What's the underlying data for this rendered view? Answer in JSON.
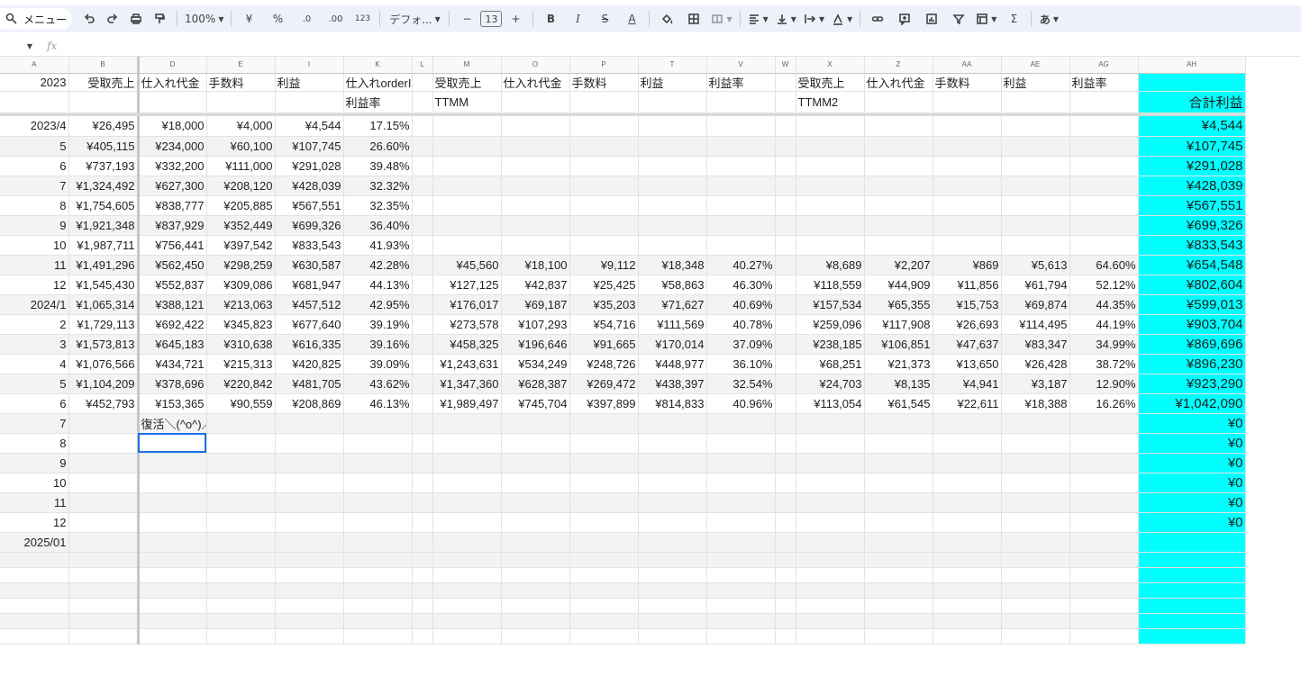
{
  "toolbar": {
    "menu_label": "メニュー",
    "zoom": "100%",
    "yen": "¥",
    "percent": "%",
    "dec_minus": ".0",
    "dec_plus": ".00",
    "num_format": "123",
    "font": "デフォ...",
    "font_size": "13",
    "minus": "−",
    "plus": "+",
    "bold": "B",
    "italic": "I",
    "strike": "S",
    "text_color": "A",
    "sigma": "Σ",
    "input_tools": "あ"
  },
  "formula_bar": {
    "fx": "fx"
  },
  "columns": [
    "A",
    "B",
    "D",
    "E",
    "I",
    "K",
    "L",
    "M",
    "O",
    "P",
    "T",
    "V",
    "W",
    "X",
    "Z",
    "AA",
    "AE",
    "AG",
    "AH"
  ],
  "header1": [
    "2023",
    "受取売上",
    "仕入れ代金",
    "手数料",
    "利益",
    "仕入れorderID",
    "",
    "受取売上",
    "仕入れ代金",
    "手数料",
    "利益",
    "利益率",
    "",
    "受取売上",
    "仕入れ代金",
    "手数料",
    "利益",
    "利益率",
    ""
  ],
  "header2": [
    "",
    "",
    "",
    "",
    "",
    "利益率",
    "",
    "TTMM",
    "",
    "",
    "",
    "",
    "",
    "TTMM2",
    "",
    "",
    "",
    "",
    "合計利益"
  ],
  "rows": [
    [
      "2023/4",
      "¥26,495",
      "¥18,000",
      "¥4,000",
      "¥4,544",
      "17.15%",
      "",
      "",
      "",
      "",
      "",
      "",
      "",
      "",
      "",
      "",
      "",
      "",
      "¥4,544"
    ],
    [
      "5",
      "¥405,115",
      "¥234,000",
      "¥60,100",
      "¥107,745",
      "26.60%",
      "",
      "",
      "",
      "",
      "",
      "",
      "",
      "",
      "",
      "",
      "",
      "",
      "¥107,745"
    ],
    [
      "6",
      "¥737,193",
      "¥332,200",
      "¥111,000",
      "¥291,028",
      "39.48%",
      "",
      "",
      "",
      "",
      "",
      "",
      "",
      "",
      "",
      "",
      "",
      "",
      "¥291,028"
    ],
    [
      "7",
      "¥1,324,492",
      "¥627,300",
      "¥208,120",
      "¥428,039",
      "32.32%",
      "",
      "",
      "",
      "",
      "",
      "",
      "",
      "",
      "",
      "",
      "",
      "",
      "¥428,039"
    ],
    [
      "8",
      "¥1,754,605",
      "¥838,777",
      "¥205,885",
      "¥567,551",
      "32.35%",
      "",
      "",
      "",
      "",
      "",
      "",
      "",
      "",
      "",
      "",
      "",
      "",
      "¥567,551"
    ],
    [
      "9",
      "¥1,921,348",
      "¥837,929",
      "¥352,449",
      "¥699,326",
      "36.40%",
      "",
      "",
      "",
      "",
      "",
      "",
      "",
      "",
      "",
      "",
      "",
      "",
      "¥699,326"
    ],
    [
      "10",
      "¥1,987,711",
      "¥756,441",
      "¥397,542",
      "¥833,543",
      "41.93%",
      "",
      "",
      "",
      "",
      "",
      "",
      "",
      "",
      "",
      "",
      "",
      "",
      "¥833,543"
    ],
    [
      "11",
      "¥1,491,296",
      "¥562,450",
      "¥298,259",
      "¥630,587",
      "42.28%",
      "",
      "¥45,560",
      "¥18,100",
      "¥9,112",
      "¥18,348",
      "40.27%",
      "",
      "¥8,689",
      "¥2,207",
      "¥869",
      "¥5,613",
      "64.60%",
      "¥654,548"
    ],
    [
      "12",
      "¥1,545,430",
      "¥552,837",
      "¥309,086",
      "¥681,947",
      "44.13%",
      "",
      "¥127,125",
      "¥42,837",
      "¥25,425",
      "¥58,863",
      "46.30%",
      "",
      "¥118,559",
      "¥44,909",
      "¥11,856",
      "¥61,794",
      "52.12%",
      "¥802,604"
    ],
    [
      "2024/1",
      "¥1,065,314",
      "¥388,121",
      "¥213,063",
      "¥457,512",
      "42.95%",
      "",
      "¥176,017",
      "¥69,187",
      "¥35,203",
      "¥71,627",
      "40.69%",
      "",
      "¥157,534",
      "¥65,355",
      "¥15,753",
      "¥69,874",
      "44.35%",
      "¥599,013"
    ],
    [
      "2",
      "¥1,729,113",
      "¥692,422",
      "¥345,823",
      "¥677,640",
      "39.19%",
      "",
      "¥273,578",
      "¥107,293",
      "¥54,716",
      "¥111,569",
      "40.78%",
      "",
      "¥259,096",
      "¥117,908",
      "¥26,693",
      "¥114,495",
      "44.19%",
      "¥903,704"
    ],
    [
      "3",
      "¥1,573,813",
      "¥645,183",
      "¥310,638",
      "¥616,335",
      "39.16%",
      "",
      "¥458,325",
      "¥196,646",
      "¥91,665",
      "¥170,014",
      "37.09%",
      "",
      "¥238,185",
      "¥106,851",
      "¥47,637",
      "¥83,347",
      "34.99%",
      "¥869,696"
    ],
    [
      "4",
      "¥1,076,566",
      "¥434,721",
      "¥215,313",
      "¥420,825",
      "39.09%",
      "",
      "¥1,243,631",
      "¥534,249",
      "¥248,726",
      "¥448,977",
      "36.10%",
      "",
      "¥68,251",
      "¥21,373",
      "¥13,650",
      "¥26,428",
      "38.72%",
      "¥896,230"
    ],
    [
      "5",
      "¥1,104,209",
      "¥378,696",
      "¥220,842",
      "¥481,705",
      "43.62%",
      "",
      "¥1,347,360",
      "¥628,387",
      "¥269,472",
      "¥438,397",
      "32.54%",
      "",
      "¥24,703",
      "¥8,135",
      "¥4,941",
      "¥3,187",
      "12.90%",
      "¥923,290"
    ],
    [
      "6",
      "¥452,793",
      "¥153,365",
      "¥90,559",
      "¥208,869",
      "46.13%",
      "",
      "¥1,989,497",
      "¥745,704",
      "¥397,899",
      "¥814,833",
      "40.96%",
      "",
      "¥113,054",
      "¥61,545",
      "¥22,611",
      "¥18,388",
      "16.26%",
      "¥1,042,090"
    ],
    [
      "7",
      "",
      "復活＼(^o^)／",
      "",
      "",
      "",
      "",
      "",
      "",
      "",
      "",
      "",
      "",
      "",
      "",
      "",
      "",
      "",
      "¥0"
    ],
    [
      "8",
      "",
      "",
      "",
      "",
      "",
      "",
      "",
      "",
      "",
      "",
      "",
      "",
      "",
      "",
      "",
      "",
      "",
      "¥0"
    ],
    [
      "9",
      "",
      "",
      "",
      "",
      "",
      "",
      "",
      "",
      "",
      "",
      "",
      "",
      "",
      "",
      "",
      "",
      "",
      "¥0"
    ],
    [
      "10",
      "",
      "",
      "",
      "",
      "",
      "",
      "",
      "",
      "",
      "",
      "",
      "",
      "",
      "",
      "",
      "",
      "",
      "¥0"
    ],
    [
      "11",
      "",
      "",
      "",
      "",
      "",
      "",
      "",
      "",
      "",
      "",
      "",
      "",
      "",
      "",
      "",
      "",
      "",
      "¥0"
    ],
    [
      "12",
      "",
      "",
      "",
      "",
      "",
      "",
      "",
      "",
      "",
      "",
      "",
      "",
      "",
      "",
      "",
      "",
      "",
      "¥0"
    ],
    [
      "2025/01",
      "",
      "",
      "",
      "",
      "",
      "",
      "",
      "",
      "",
      "",
      "",
      "",
      "",
      "",
      "",
      "",
      "",
      ""
    ]
  ],
  "colors": {
    "highlight": "#00ffff",
    "selection": "#1a73e8",
    "toolbar_bg": "#edf2fa"
  }
}
